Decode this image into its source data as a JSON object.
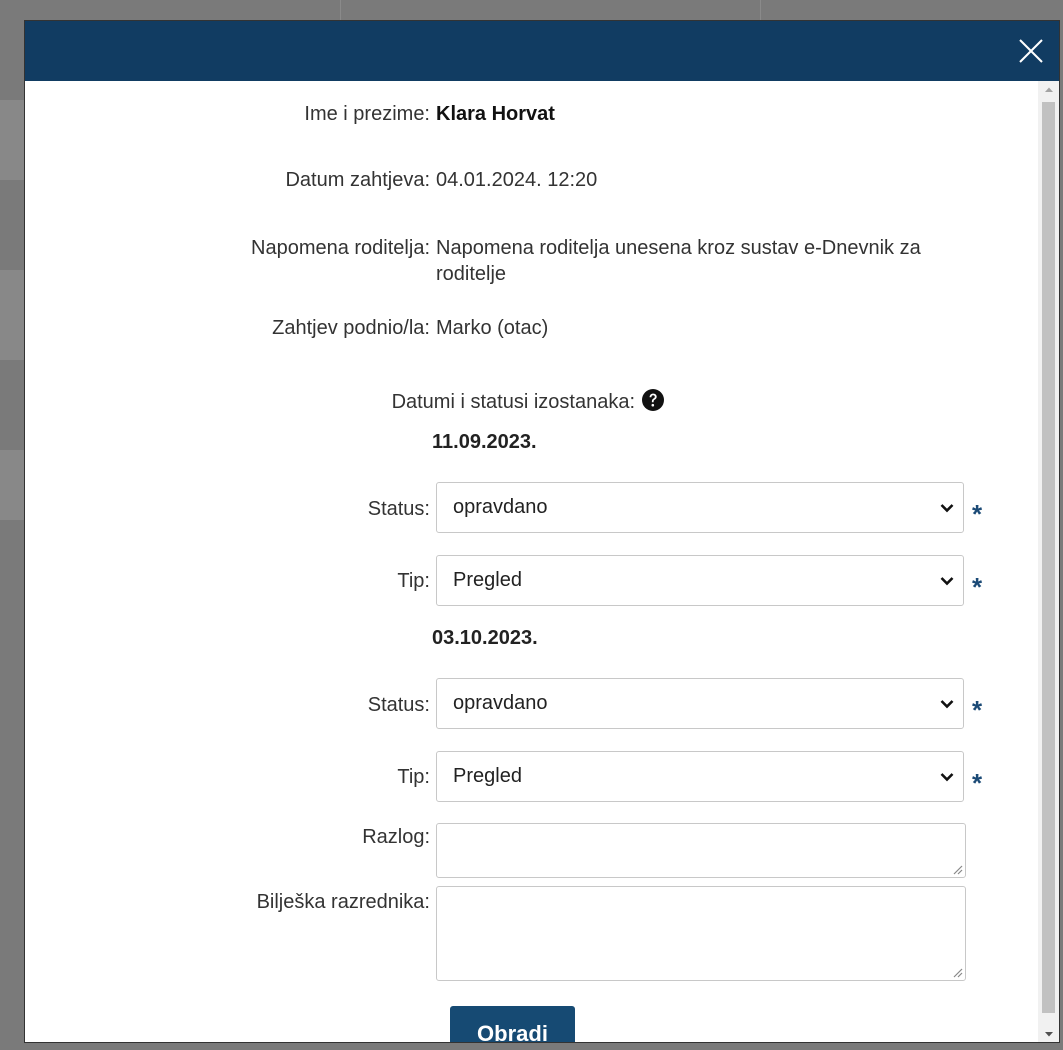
{
  "dialog": {
    "close_label": "×"
  },
  "details": {
    "name_label": "Ime i prezime:",
    "name_value": "Klara Horvat",
    "date_label": "Datum zahtjeva:",
    "date_value": "04.01.2024. 12:20",
    "note_label": "Napomena roditelja:",
    "note_value": "Napomena roditelja unesena kroz sustav e-Dnevnik za roditelje",
    "submitter_label": "Zahtjev podnio/la:",
    "submitter_value": "Marko (otac)",
    "absences_label": "Datumi i statusi izostanaka:"
  },
  "absences": [
    {
      "date": "11.09.2023.",
      "status_label": "Status:",
      "status_value": "opravdano",
      "type_label": "Tip:",
      "type_value": "Pregled",
      "required_mark": "*"
    },
    {
      "date": "03.10.2023.",
      "status_label": "Status:",
      "status_value": "opravdano",
      "type_label": "Tip:",
      "type_value": "Pregled",
      "required_mark": "*"
    }
  ],
  "form": {
    "reason_label": "Razlog:",
    "reason_value": "",
    "teacher_note_label": "Bilješka razrednika:",
    "teacher_note_value": "",
    "submit_label": "Obradi"
  },
  "colors": {
    "header": "#113c62",
    "button": "#164a73",
    "required": "#1b4a76"
  },
  "icons": {
    "close": "close-icon",
    "help": "question-circle-icon",
    "dropdown": "chevron-down-icon",
    "resize": "resize-grip-icon"
  }
}
